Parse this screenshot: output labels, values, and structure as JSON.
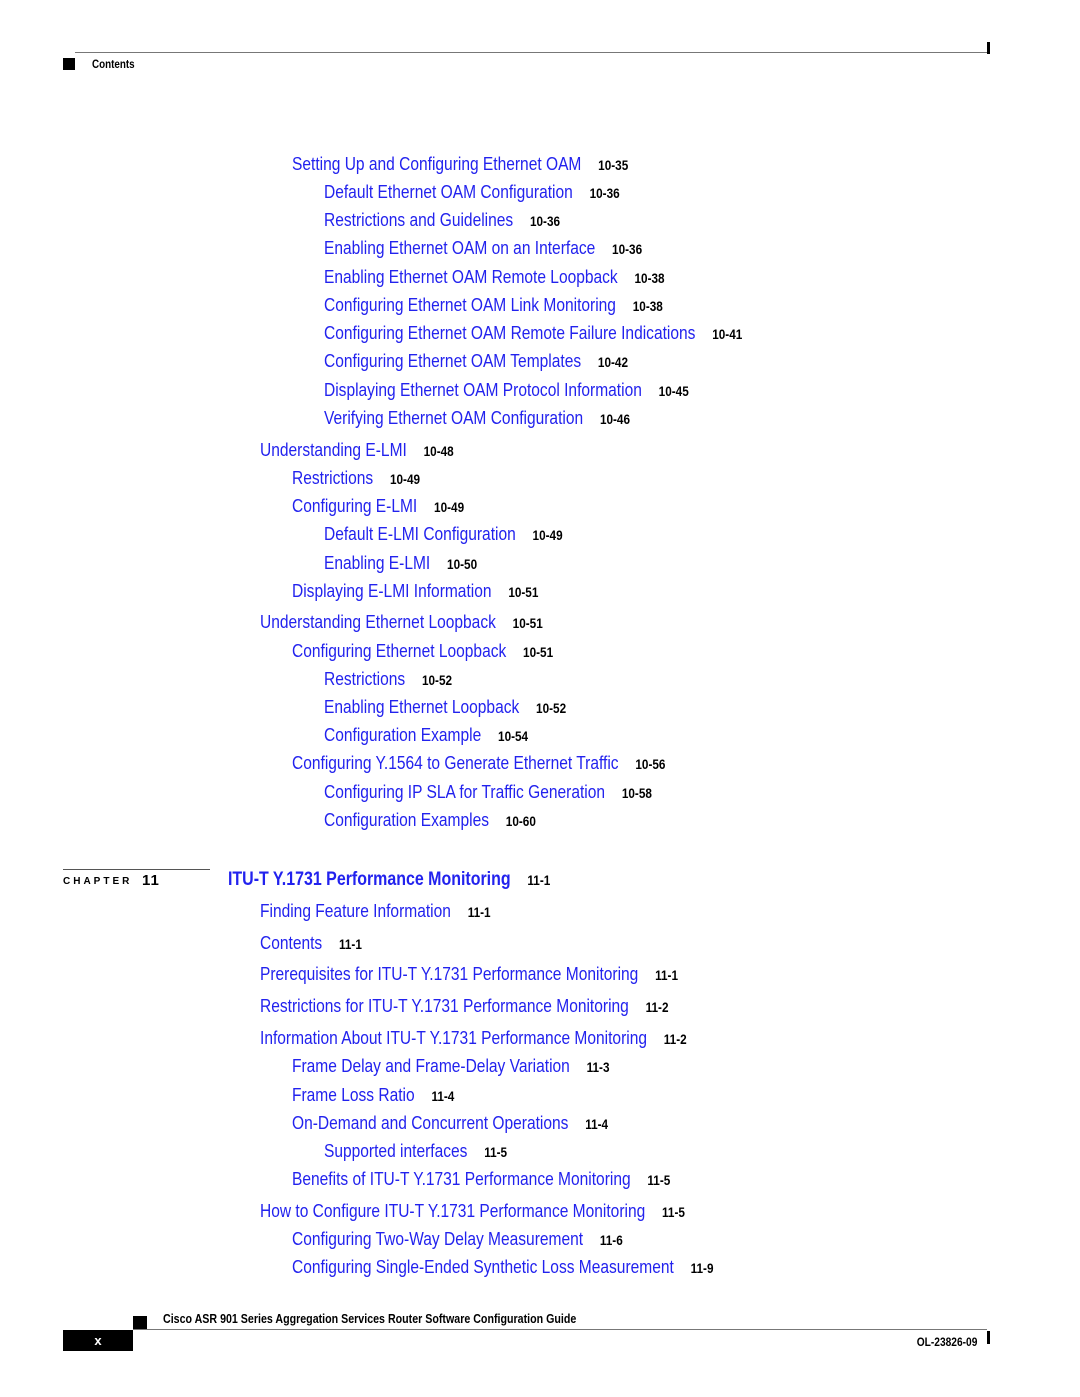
{
  "header": {
    "section_label": "Contents"
  },
  "chapter": {
    "label": "CHAPTER",
    "number": "11"
  },
  "toc": [
    {
      "level": 2,
      "title": "Setting Up and Configuring Ethernet OAM",
      "page": "10-35"
    },
    {
      "level": 3,
      "title": "Default Ethernet OAM Configuration",
      "page": "10-36"
    },
    {
      "level": 3,
      "title": "Restrictions and Guidelines",
      "page": "10-36"
    },
    {
      "level": 3,
      "title": "Enabling Ethernet OAM on an Interface",
      "page": "10-36"
    },
    {
      "level": 3,
      "title": "Enabling Ethernet OAM Remote Loopback",
      "page": "10-38"
    },
    {
      "level": 3,
      "title": "Configuring Ethernet OAM Link Monitoring",
      "page": "10-38"
    },
    {
      "level": 3,
      "title": "Configuring Ethernet OAM Remote Failure Indications",
      "page": "10-41"
    },
    {
      "level": 3,
      "title": "Configuring Ethernet OAM Templates",
      "page": "10-42"
    },
    {
      "level": 3,
      "title": "Displaying Ethernet OAM Protocol Information",
      "page": "10-45"
    },
    {
      "level": 3,
      "title": "Verifying Ethernet OAM Configuration",
      "page": "10-46"
    },
    {
      "level": 1,
      "title": "Understanding E-LMI",
      "page": "10-48"
    },
    {
      "level": 2,
      "title": "Restrictions",
      "page": "10-49"
    },
    {
      "level": 2,
      "title": "Configuring E-LMI",
      "page": "10-49"
    },
    {
      "level": 3,
      "title": "Default E-LMI Configuration",
      "page": "10-49"
    },
    {
      "level": 3,
      "title": "Enabling E-LMI",
      "page": "10-50"
    },
    {
      "level": 2,
      "title": "Displaying E-LMI Information",
      "page": "10-51"
    },
    {
      "level": 1,
      "title": "Understanding Ethernet Loopback",
      "page": "10-51"
    },
    {
      "level": 2,
      "title": "Configuring Ethernet Loopback",
      "page": "10-51"
    },
    {
      "level": 3,
      "title": "Restrictions",
      "page": "10-52"
    },
    {
      "level": 3,
      "title": "Enabling Ethernet Loopback",
      "page": "10-52"
    },
    {
      "level": 3,
      "title": "Configuration Example",
      "page": "10-54"
    },
    {
      "level": 2,
      "title": "Configuring Y.1564 to Generate Ethernet Traffic",
      "page": "10-56"
    },
    {
      "level": 3,
      "title": "Configuring IP SLA for Traffic Generation",
      "page": "10-58"
    },
    {
      "level": 3,
      "title": "Configuration Examples",
      "page": "10-60"
    },
    {
      "level": 0,
      "title": "ITU-T Y.1731 Performance Monitoring",
      "page": "11-1"
    },
    {
      "level": 1,
      "title": "Finding Feature Information",
      "page": "11-1"
    },
    {
      "level": 1,
      "title": "Contents",
      "page": "11-1"
    },
    {
      "level": 1,
      "title": "Prerequisites for ITU-T Y.1731 Performance Monitoring",
      "page": "11-1"
    },
    {
      "level": 1,
      "title": "Restrictions for ITU-T Y.1731 Performance Monitoring",
      "page": "11-2"
    },
    {
      "level": 1,
      "title": "Information About ITU-T Y.1731 Performance Monitoring",
      "page": "11-2"
    },
    {
      "level": 2,
      "title": "Frame Delay and Frame-Delay Variation",
      "page": "11-3"
    },
    {
      "level": 2,
      "title": "Frame Loss Ratio",
      "page": "11-4"
    },
    {
      "level": 2,
      "title": "On-Demand and Concurrent Operations",
      "page": "11-4"
    },
    {
      "level": 3,
      "title": "Supported interfaces",
      "page": "11-5"
    },
    {
      "level": 2,
      "title": "Benefits of ITU-T Y.1731 Performance Monitoring",
      "page": "11-5"
    },
    {
      "level": 1,
      "title": "How to Configure ITU-T Y.1731 Performance Monitoring",
      "page": "11-5"
    },
    {
      "level": 2,
      "title": "Configuring Two-Way Delay Measurement",
      "page": "11-6"
    },
    {
      "level": 2,
      "title": "Configuring Single-Ended Synthetic Loss Measurement",
      "page": "11-9"
    }
  ],
  "footer": {
    "guide_title": "Cisco ASR 901 Series Aggregation Services Router Software Configuration Guide",
    "page_number": "x",
    "doc_number": "OL-23826-09"
  },
  "colors": {
    "link": "#2222ee",
    "page_number": "#000000"
  }
}
